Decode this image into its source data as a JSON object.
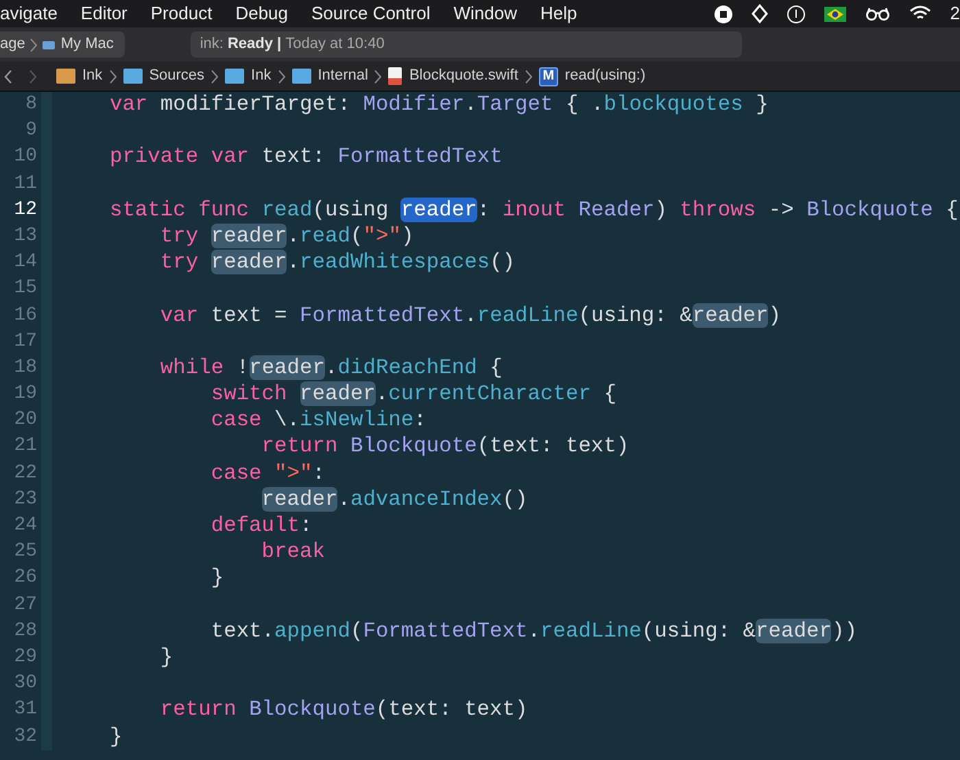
{
  "menu_bar": {
    "items": [
      "avigate",
      "Editor",
      "Product",
      "Debug",
      "Source Control",
      "Window",
      "Help"
    ],
    "clock_fragment": "2"
  },
  "toolbar": {
    "scheme": "age",
    "destination": "My Mac",
    "activity": {
      "project": "ink:",
      "status": "Ready |",
      "time": "Today at 10:40"
    }
  },
  "breadcrumbs": [
    {
      "kind": "project",
      "label": "Ink"
    },
    {
      "kind": "folder",
      "label": "Sources"
    },
    {
      "kind": "folder",
      "label": "Ink"
    },
    {
      "kind": "folder",
      "label": "Internal"
    },
    {
      "kind": "file",
      "label": "Blockquote.swift"
    },
    {
      "kind": "method",
      "badge": "M",
      "label": "read(using:)"
    }
  ],
  "editor": {
    "lines": [
      {
        "number": "8",
        "current": false,
        "tokens": [
          {
            "text": "    var",
            "kind": "keyword"
          },
          {
            "text": " modifierTarget: ",
            "kind": "plain"
          },
          {
            "text": "Modifier",
            "kind": "type"
          },
          {
            "text": ".",
            "kind": "plain"
          },
          {
            "text": "Target",
            "kind": "type"
          },
          {
            "text": " { .",
            "kind": "plain"
          },
          {
            "text": "blockquotes",
            "kind": "func"
          },
          {
            "text": " }",
            "kind": "plain"
          }
        ]
      },
      {
        "number": "9",
        "current": false
      },
      {
        "number": "10",
        "current": false,
        "tokens": [
          {
            "text": "    private var",
            "kind": "keyword"
          },
          {
            "text": " text: ",
            "kind": "plain"
          },
          {
            "text": "FormattedText",
            "kind": "type"
          }
        ]
      },
      {
        "number": "11",
        "current": false
      },
      {
        "number": "12",
        "current": true,
        "tokens": [
          {
            "text": "    static func",
            "kind": "keyword"
          },
          {
            "text": " read",
            "kind": "func"
          },
          {
            "text": "(using ",
            "kind": "plain"
          },
          {
            "text": "reader",
            "kind": "selected"
          },
          {
            "text": ": ",
            "kind": "plain"
          },
          {
            "text": "inout",
            "kind": "keyword"
          },
          {
            "text": " Reader",
            "kind": "type"
          },
          {
            "text": ") ",
            "kind": "plain"
          },
          {
            "text": "throws",
            "kind": "keyword"
          },
          {
            "text": " -> ",
            "kind": "plain"
          },
          {
            "text": "Blockquote",
            "kind": "type"
          },
          {
            "text": " {",
            "kind": "plain"
          }
        ]
      },
      {
        "number": "13",
        "current": false,
        "tokens": [
          {
            "text": "        try ",
            "kind": "keyword"
          },
          {
            "text": "reader",
            "kind": "match"
          },
          {
            "text": ".",
            "kind": "plain"
          },
          {
            "text": "read",
            "kind": "func"
          },
          {
            "text": "(",
            "kind": "plain"
          },
          {
            "text": "\">\"",
            "kind": "string"
          },
          {
            "text": ")",
            "kind": "plain"
          }
        ]
      },
      {
        "number": "14",
        "current": false,
        "tokens": [
          {
            "text": "        try ",
            "kind": "keyword"
          },
          {
            "text": "reader",
            "kind": "match"
          },
          {
            "text": ".",
            "kind": "plain"
          },
          {
            "text": "readWhitespaces",
            "kind": "func"
          },
          {
            "text": "()",
            "kind": "plain"
          }
        ]
      },
      {
        "number": "15",
        "current": false
      },
      {
        "number": "16",
        "current": false,
        "tokens": [
          {
            "text": "        var",
            "kind": "keyword"
          },
          {
            "text": " text = ",
            "kind": "plain"
          },
          {
            "text": "FormattedText",
            "kind": "type"
          },
          {
            "text": ".",
            "kind": "plain"
          },
          {
            "text": "readLine",
            "kind": "func"
          },
          {
            "text": "(using: &",
            "kind": "plain"
          },
          {
            "text": "reader",
            "kind": "match"
          },
          {
            "text": ")",
            "kind": "plain"
          }
        ]
      },
      {
        "number": "17",
        "current": false
      },
      {
        "number": "18",
        "current": false,
        "tokens": [
          {
            "text": "        while",
            "kind": "keyword"
          },
          {
            "text": " !",
            "kind": "plain"
          },
          {
            "text": "reader",
            "kind": "match"
          },
          {
            "text": ".",
            "kind": "plain"
          },
          {
            "text": "didReachEnd",
            "kind": "func"
          },
          {
            "text": " {",
            "kind": "plain"
          }
        ]
      },
      {
        "number": "19",
        "current": false,
        "tokens": [
          {
            "text": "            switch ",
            "kind": "keyword"
          },
          {
            "text": "reader",
            "kind": "match"
          },
          {
            "text": ".",
            "kind": "plain"
          },
          {
            "text": "currentCharacter",
            "kind": "func"
          },
          {
            "text": " {",
            "kind": "plain"
          }
        ]
      },
      {
        "number": "20",
        "current": false,
        "tokens": [
          {
            "text": "            case",
            "kind": "keyword"
          },
          {
            "text": " \\.",
            "kind": "plain"
          },
          {
            "text": "isNewline",
            "kind": "func"
          },
          {
            "text": ":",
            "kind": "plain"
          }
        ]
      },
      {
        "number": "21",
        "current": false,
        "tokens": [
          {
            "text": "                return",
            "kind": "keyword"
          },
          {
            "text": " Blockquote",
            "kind": "type"
          },
          {
            "text": "(text: text)",
            "kind": "plain"
          }
        ]
      },
      {
        "number": "22",
        "current": false,
        "tokens": [
          {
            "text": "            case",
            "kind": "keyword"
          },
          {
            "text": " \">\"",
            "kind": "string"
          },
          {
            "text": ":",
            "kind": "plain"
          }
        ]
      },
      {
        "number": "23",
        "current": false,
        "tokens": [
          {
            "text": "                reader",
            "kind": "match"
          },
          {
            "text": ".",
            "kind": "plain"
          },
          {
            "text": "advanceIndex",
            "kind": "func"
          },
          {
            "text": "()",
            "kind": "plain"
          }
        ]
      },
      {
        "number": "24",
        "current": false,
        "tokens": [
          {
            "text": "            default",
            "kind": "keyword"
          },
          {
            "text": ":",
            "kind": "plain"
          }
        ]
      },
      {
        "number": "25",
        "current": false,
        "tokens": [
          {
            "text": "                break",
            "kind": "keyword"
          }
        ]
      },
      {
        "number": "26",
        "current": false,
        "tokens": [
          {
            "text": "            }",
            "kind": "plain"
          }
        ]
      },
      {
        "number": "27",
        "current": false
      },
      {
        "number": "28",
        "current": false,
        "tokens": [
          {
            "text": "            text.",
            "kind": "plain"
          },
          {
            "text": "append",
            "kind": "func"
          },
          {
            "text": "(",
            "kind": "plain"
          },
          {
            "text": "FormattedText",
            "kind": "type"
          },
          {
            "text": ".",
            "kind": "plain"
          },
          {
            "text": "readLine",
            "kind": "func"
          },
          {
            "text": "(using: &",
            "kind": "plain"
          },
          {
            "text": "reader",
            "kind": "match"
          },
          {
            "text": "))",
            "kind": "plain"
          }
        ]
      },
      {
        "number": "29",
        "current": false,
        "tokens": [
          {
            "text": "        }",
            "kind": "plain"
          }
        ]
      },
      {
        "number": "30",
        "current": false
      },
      {
        "number": "31",
        "current": false,
        "tokens": [
          {
            "text": "        return",
            "kind": "keyword"
          },
          {
            "text": " Blockquote",
            "kind": "type"
          },
          {
            "text": "(text: text)",
            "kind": "plain"
          }
        ]
      },
      {
        "number": "32",
        "current": false,
        "tokens": [
          {
            "text": "    }",
            "kind": "plain"
          }
        ]
      }
    ]
  }
}
